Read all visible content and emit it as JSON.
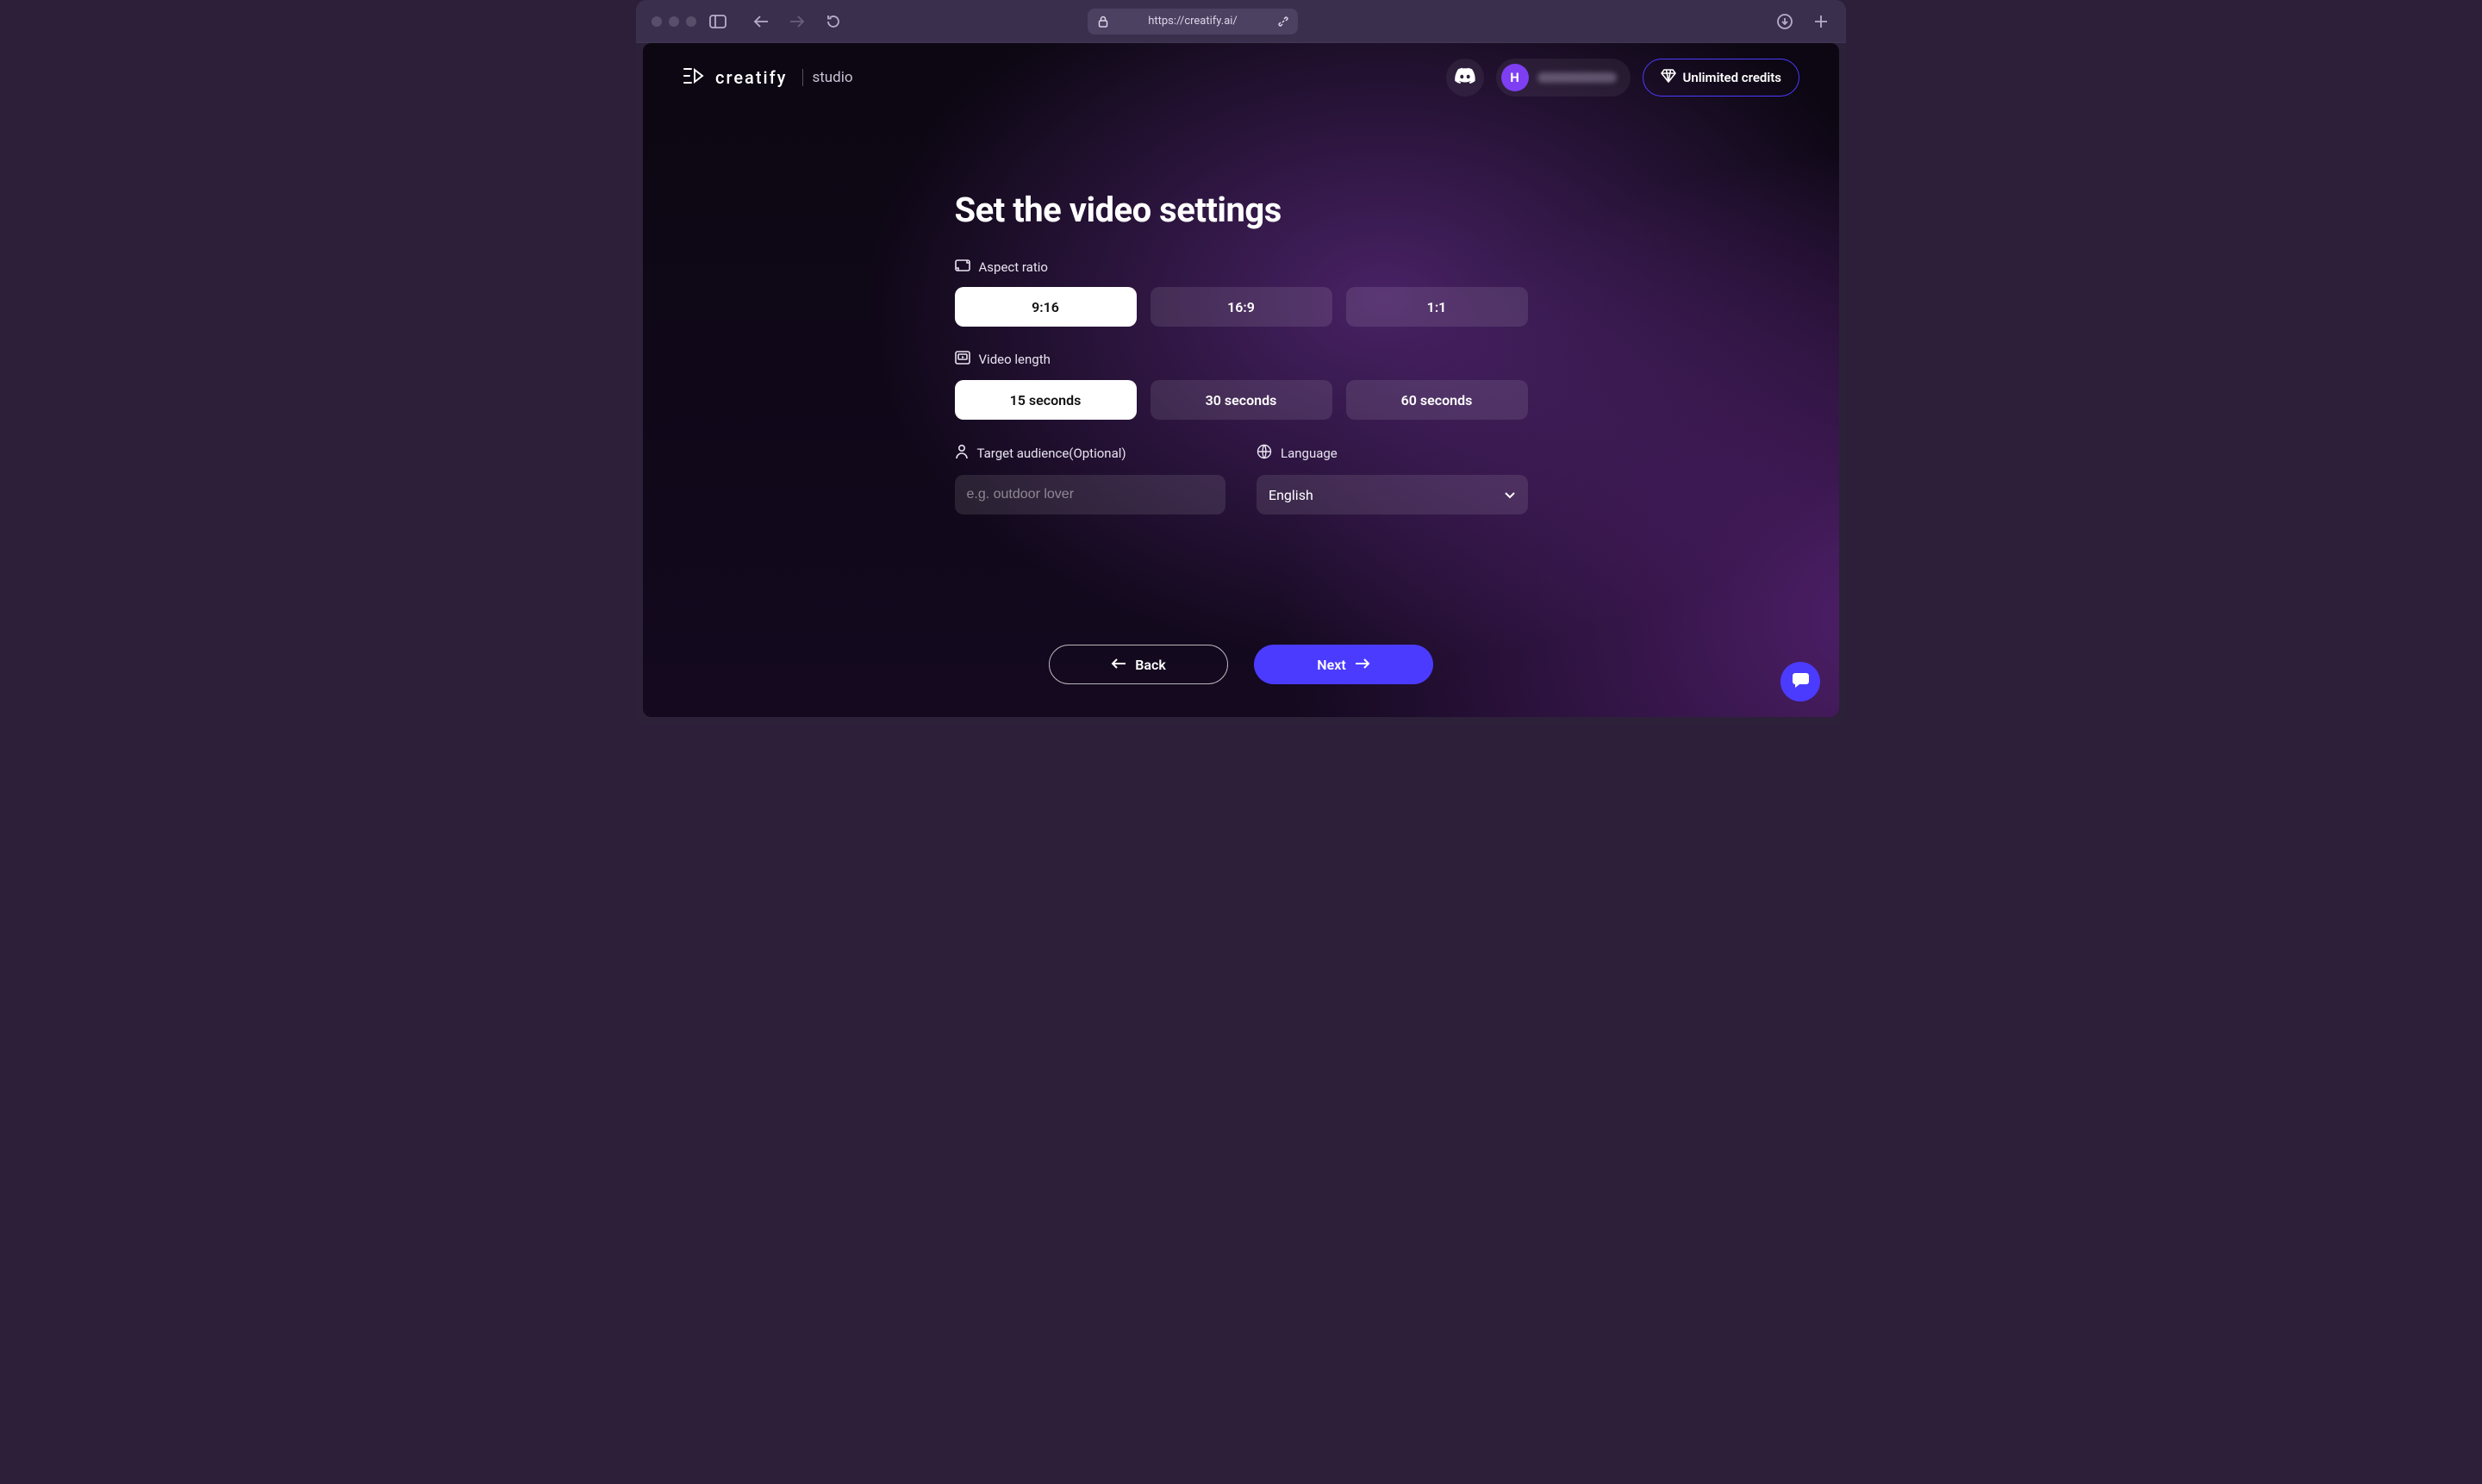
{
  "browser": {
    "url": "https://creatify.ai/"
  },
  "header": {
    "brand": "creatify",
    "brand_sub": "studio",
    "avatar_initial": "H",
    "credits_label": "Unlimited credits"
  },
  "page": {
    "title": "Set the video settings",
    "aspect": {
      "label": "Aspect ratio",
      "options": [
        "9:16",
        "16:9",
        "1:1"
      ],
      "selected": 0
    },
    "length": {
      "label": "Video length",
      "options": [
        "15 seconds",
        "30 seconds",
        "60 seconds"
      ],
      "selected": 0
    },
    "audience": {
      "label": "Target audience(Optional)",
      "placeholder": "e.g. outdoor lover",
      "value": ""
    },
    "language": {
      "label": "Language",
      "value": "English"
    },
    "nav": {
      "back": "Back",
      "next": "Next"
    }
  }
}
